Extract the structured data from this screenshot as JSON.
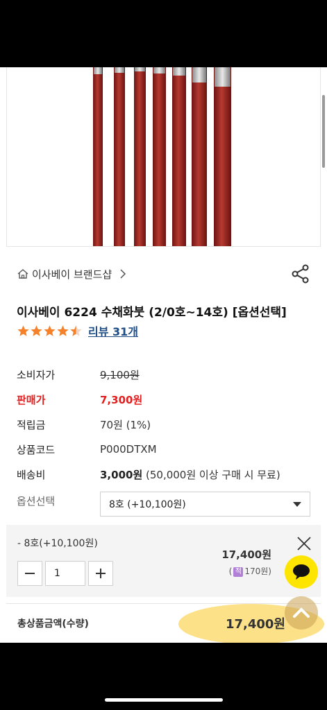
{
  "brand": {
    "label": "이사베이 브랜드샵"
  },
  "product": {
    "title": "이사베이 6224 수채화붓 (2/0호~14호) [옵션선택]",
    "rating": 4.5,
    "review_link": "리뷰 31개"
  },
  "info": {
    "consumer_price_label": "소비자가",
    "consumer_price": "9,100원",
    "sale_price_label": "판매가",
    "sale_price": "7,300원",
    "points_label": "적립금",
    "points": "70원 (1%)",
    "code_label": "상품코드",
    "code": "P000DTXM",
    "shipping_label": "배송비",
    "shipping_fee": "3,000원",
    "shipping_note": " (50,000원 이상 구매 시 무료)"
  },
  "option": {
    "label": "옵션선택",
    "selected": "8호 (+10,100원)"
  },
  "selected_item": {
    "name": "- 8호(+10,100원)",
    "quantity": "1",
    "price": "17,400원",
    "points_prefix": "(",
    "points_badge": "적",
    "points_value": "170원)"
  },
  "total": {
    "label": "총상품금액(수량)",
    "amount": "17,400원"
  },
  "colors": {
    "accent_red": "#e02020",
    "link_blue": "#1f4d86",
    "star_orange": "#f5822a",
    "kakao_yellow": "#fde500"
  }
}
